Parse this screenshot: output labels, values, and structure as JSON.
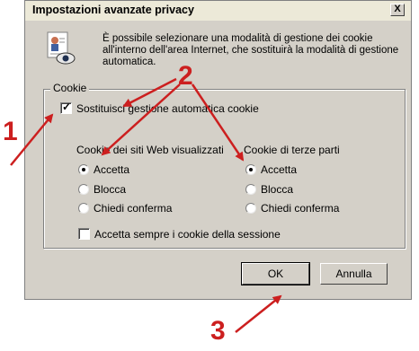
{
  "dialog": {
    "title": "Impostazioni avanzate privacy",
    "close_label": "X",
    "intro_text": "È possibile selezionare una modalità di gestione dei cookie all'interno dell'area Internet, che sostituirà la modalità di gestione automatica."
  },
  "cookie_group": {
    "label": "Cookie",
    "override_checkbox": {
      "label": "Sostituisci gestione automatica cookie",
      "checked": true
    },
    "first_party": {
      "heading": "Cookie dei siti Web visualizzati",
      "options": [
        {
          "label": "Accetta",
          "selected": true
        },
        {
          "label": "Blocca",
          "selected": false
        },
        {
          "label": "Chiedi conferma",
          "selected": false
        }
      ]
    },
    "third_party": {
      "heading": "Cookie di terze parti",
      "options": [
        {
          "label": "Accetta",
          "selected": true
        },
        {
          "label": "Blocca",
          "selected": false
        },
        {
          "label": "Chiedi conferma",
          "selected": false
        }
      ]
    },
    "session_checkbox": {
      "label": "Accetta sempre i cookie della sessione",
      "checked": false
    }
  },
  "buttons": {
    "ok": "OK",
    "cancel": "Annulla"
  },
  "annotations": {
    "step1": "1",
    "step2": "2",
    "step3": "3",
    "color": "#cc1f1f"
  }
}
